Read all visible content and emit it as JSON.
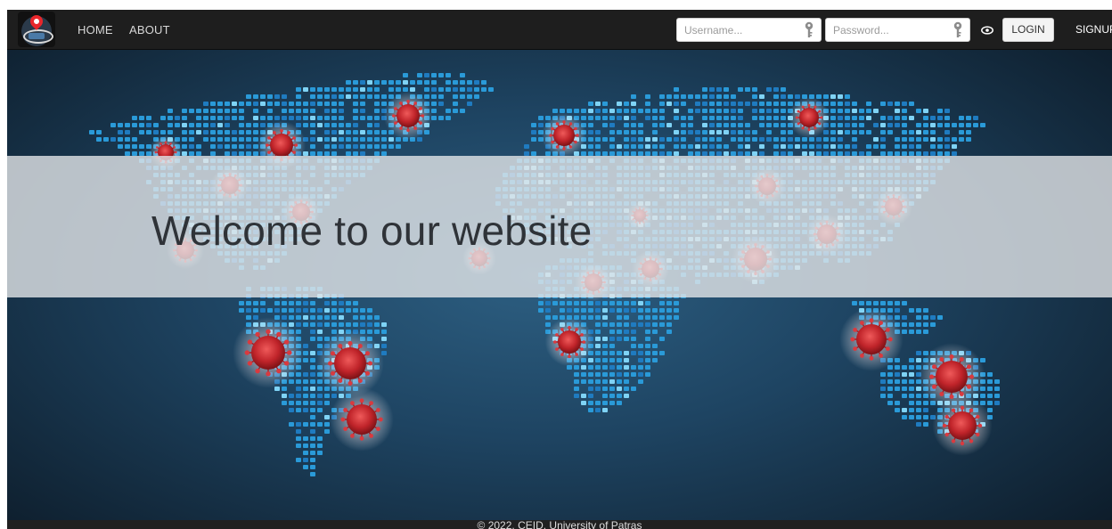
{
  "navbar": {
    "home_label": "HOME",
    "about_label": "ABOUT",
    "username_placeholder": "Username...",
    "password_placeholder": "Password...",
    "login_label": "LOGIN",
    "signup_label": "SIGNUP"
  },
  "hero": {
    "welcome_text": "Welcome to our website"
  },
  "footer": {
    "text": "© 2022, CEID, University of Patras"
  },
  "icons": {
    "logo": "app-logo-map-pin",
    "username_key": "key-icon",
    "password_key": "key-icon",
    "toggle_password": "eye-icon"
  },
  "colors": {
    "navbar_bg": "#1e1e1e",
    "map_dot": "#2a9ad8",
    "map_dot_light": "#7fd3f5",
    "virus_red": "#c0242a",
    "banner": "#e4e6e8"
  }
}
